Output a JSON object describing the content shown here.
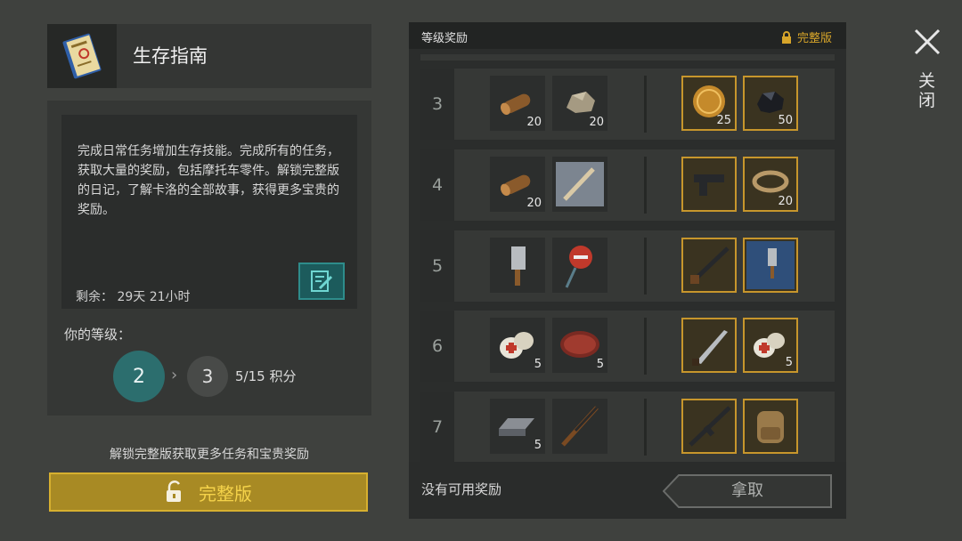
{
  "guide": {
    "title": "生存指南",
    "icon": "survival-guide-book-icon",
    "description": "完成日常任务增加生存技能。完成所有的任务，获取大量的奖励，包括摩托车零件。解锁完整版的日记，了解卡洛的全部故事，获得更多宝贵的奖励。",
    "remaining": "剩余：  29天 21小时",
    "level_label": "你的等级：",
    "current_level": "2",
    "next_level": "3",
    "points": "5/15  积分",
    "unlock_note": "解锁完整版获取更多任务和宝贵奖励",
    "full_version_button": "完整版"
  },
  "rewards": {
    "title": "等级奖励",
    "full_version_tag": "完整版",
    "rows": [
      {
        "level": "3",
        "free": [
          {
            "icon": "log-icon",
            "count": "20"
          },
          {
            "icon": "stone-icon",
            "count": "20"
          }
        ],
        "premium": [
          {
            "icon": "coin-icon",
            "count": "25"
          },
          {
            "icon": "coal-icon",
            "count": "50"
          }
        ]
      },
      {
        "level": "4",
        "free": [
          {
            "icon": "log-icon",
            "count": "20"
          },
          {
            "icon": "bat-blueprint-icon",
            "count": ""
          }
        ],
        "premium": [
          {
            "icon": "pistol-icon",
            "count": ""
          },
          {
            "icon": "rope-icon",
            "count": "20"
          }
        ]
      },
      {
        "level": "5",
        "free": [
          {
            "icon": "cleaver-icon",
            "count": ""
          },
          {
            "icon": "stop-sign-icon",
            "count": ""
          }
        ],
        "premium": [
          {
            "icon": "shotgun-icon",
            "count": ""
          },
          {
            "icon": "cleaver-blueprint-icon",
            "count": ""
          }
        ]
      },
      {
        "level": "6",
        "free": [
          {
            "icon": "bandage-icon",
            "count": "5"
          },
          {
            "icon": "steak-icon",
            "count": "5"
          }
        ],
        "premium": [
          {
            "icon": "machete-icon",
            "count": ""
          },
          {
            "icon": "bandage-icon",
            "count": "5"
          }
        ]
      },
      {
        "level": "7",
        "free": [
          {
            "icon": "iron-bar-icon",
            "count": "5"
          },
          {
            "icon": "rifle-icon",
            "count": ""
          }
        ],
        "premium": [
          {
            "icon": "assault-rifle-icon",
            "count": ""
          },
          {
            "icon": "backpack-icon",
            "count": ""
          }
        ]
      }
    ],
    "no_reward_text": "没有可用奖励",
    "take_button": "拿取"
  },
  "close_label": "关闭",
  "colors": {
    "accent_teal": "#2c6e6e",
    "gold": "#d7b02f"
  }
}
